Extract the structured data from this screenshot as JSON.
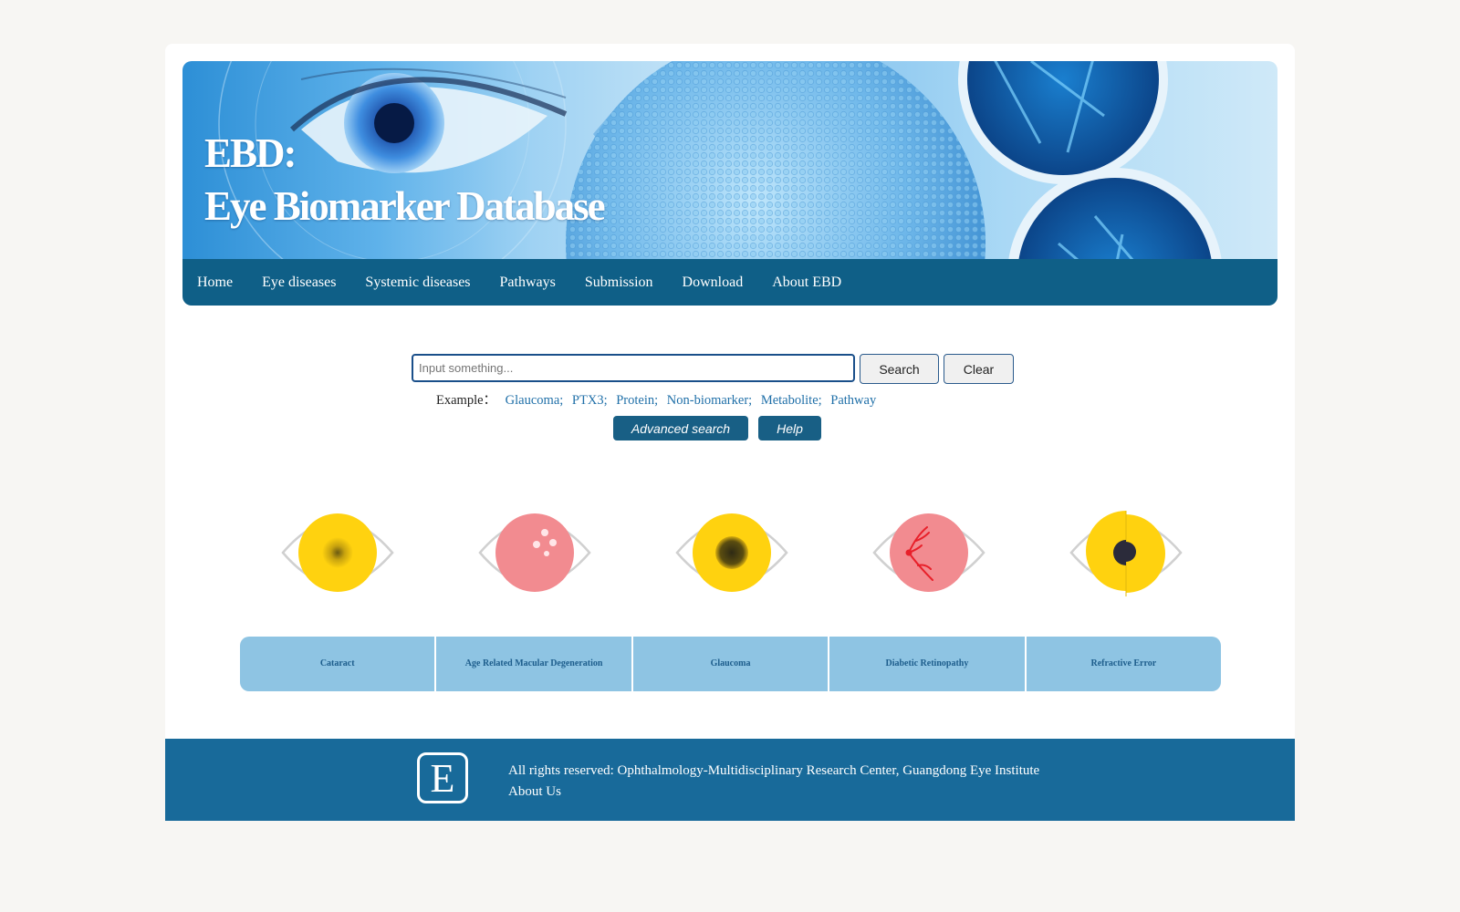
{
  "banner": {
    "title_line1": "EBD:",
    "title_line2": "Eye Biomarker Database"
  },
  "nav": {
    "items": [
      {
        "label": "Home"
      },
      {
        "label": "Eye diseases"
      },
      {
        "label": "Systemic diseases"
      },
      {
        "label": "Pathways"
      },
      {
        "label": "Submission"
      },
      {
        "label": "Download"
      },
      {
        "label": "About EBD"
      }
    ]
  },
  "search": {
    "placeholder": "Input something...",
    "search_label": "Search",
    "clear_label": "Clear",
    "example_label": "Example：",
    "examples": [
      "Glaucoma;",
      "PTX3;",
      "Protein;",
      "Non-biomarker;",
      "Metabolite;",
      "Pathway"
    ],
    "advanced_label": "Advanced search",
    "help_label": "Help"
  },
  "diseases": [
    {
      "name": "Cataract",
      "icon": "cataract-eye-icon"
    },
    {
      "name": "Age Related Macular Degeneration",
      "icon": "amd-eye-icon"
    },
    {
      "name": "Glaucoma",
      "icon": "glaucoma-eye-icon"
    },
    {
      "name": "Diabetic Retinopathy",
      "icon": "diabetic-retinopathy-eye-icon"
    },
    {
      "name": "Refractive Error",
      "icon": "refractive-error-eye-icon"
    }
  ],
  "colors": {
    "nav_bg": "#0f5f87",
    "footer_bg": "#186a9a",
    "tab_bg": "#8ec4e3",
    "iris_yellow": "#ffd20f",
    "iris_pink": "#f28b90"
  },
  "footer": {
    "logo_letter": "E",
    "rights": "All rights reserved: Ophthalmology-Multidisciplinary Research Center, Guangdong Eye Institute",
    "about": "About Us"
  }
}
